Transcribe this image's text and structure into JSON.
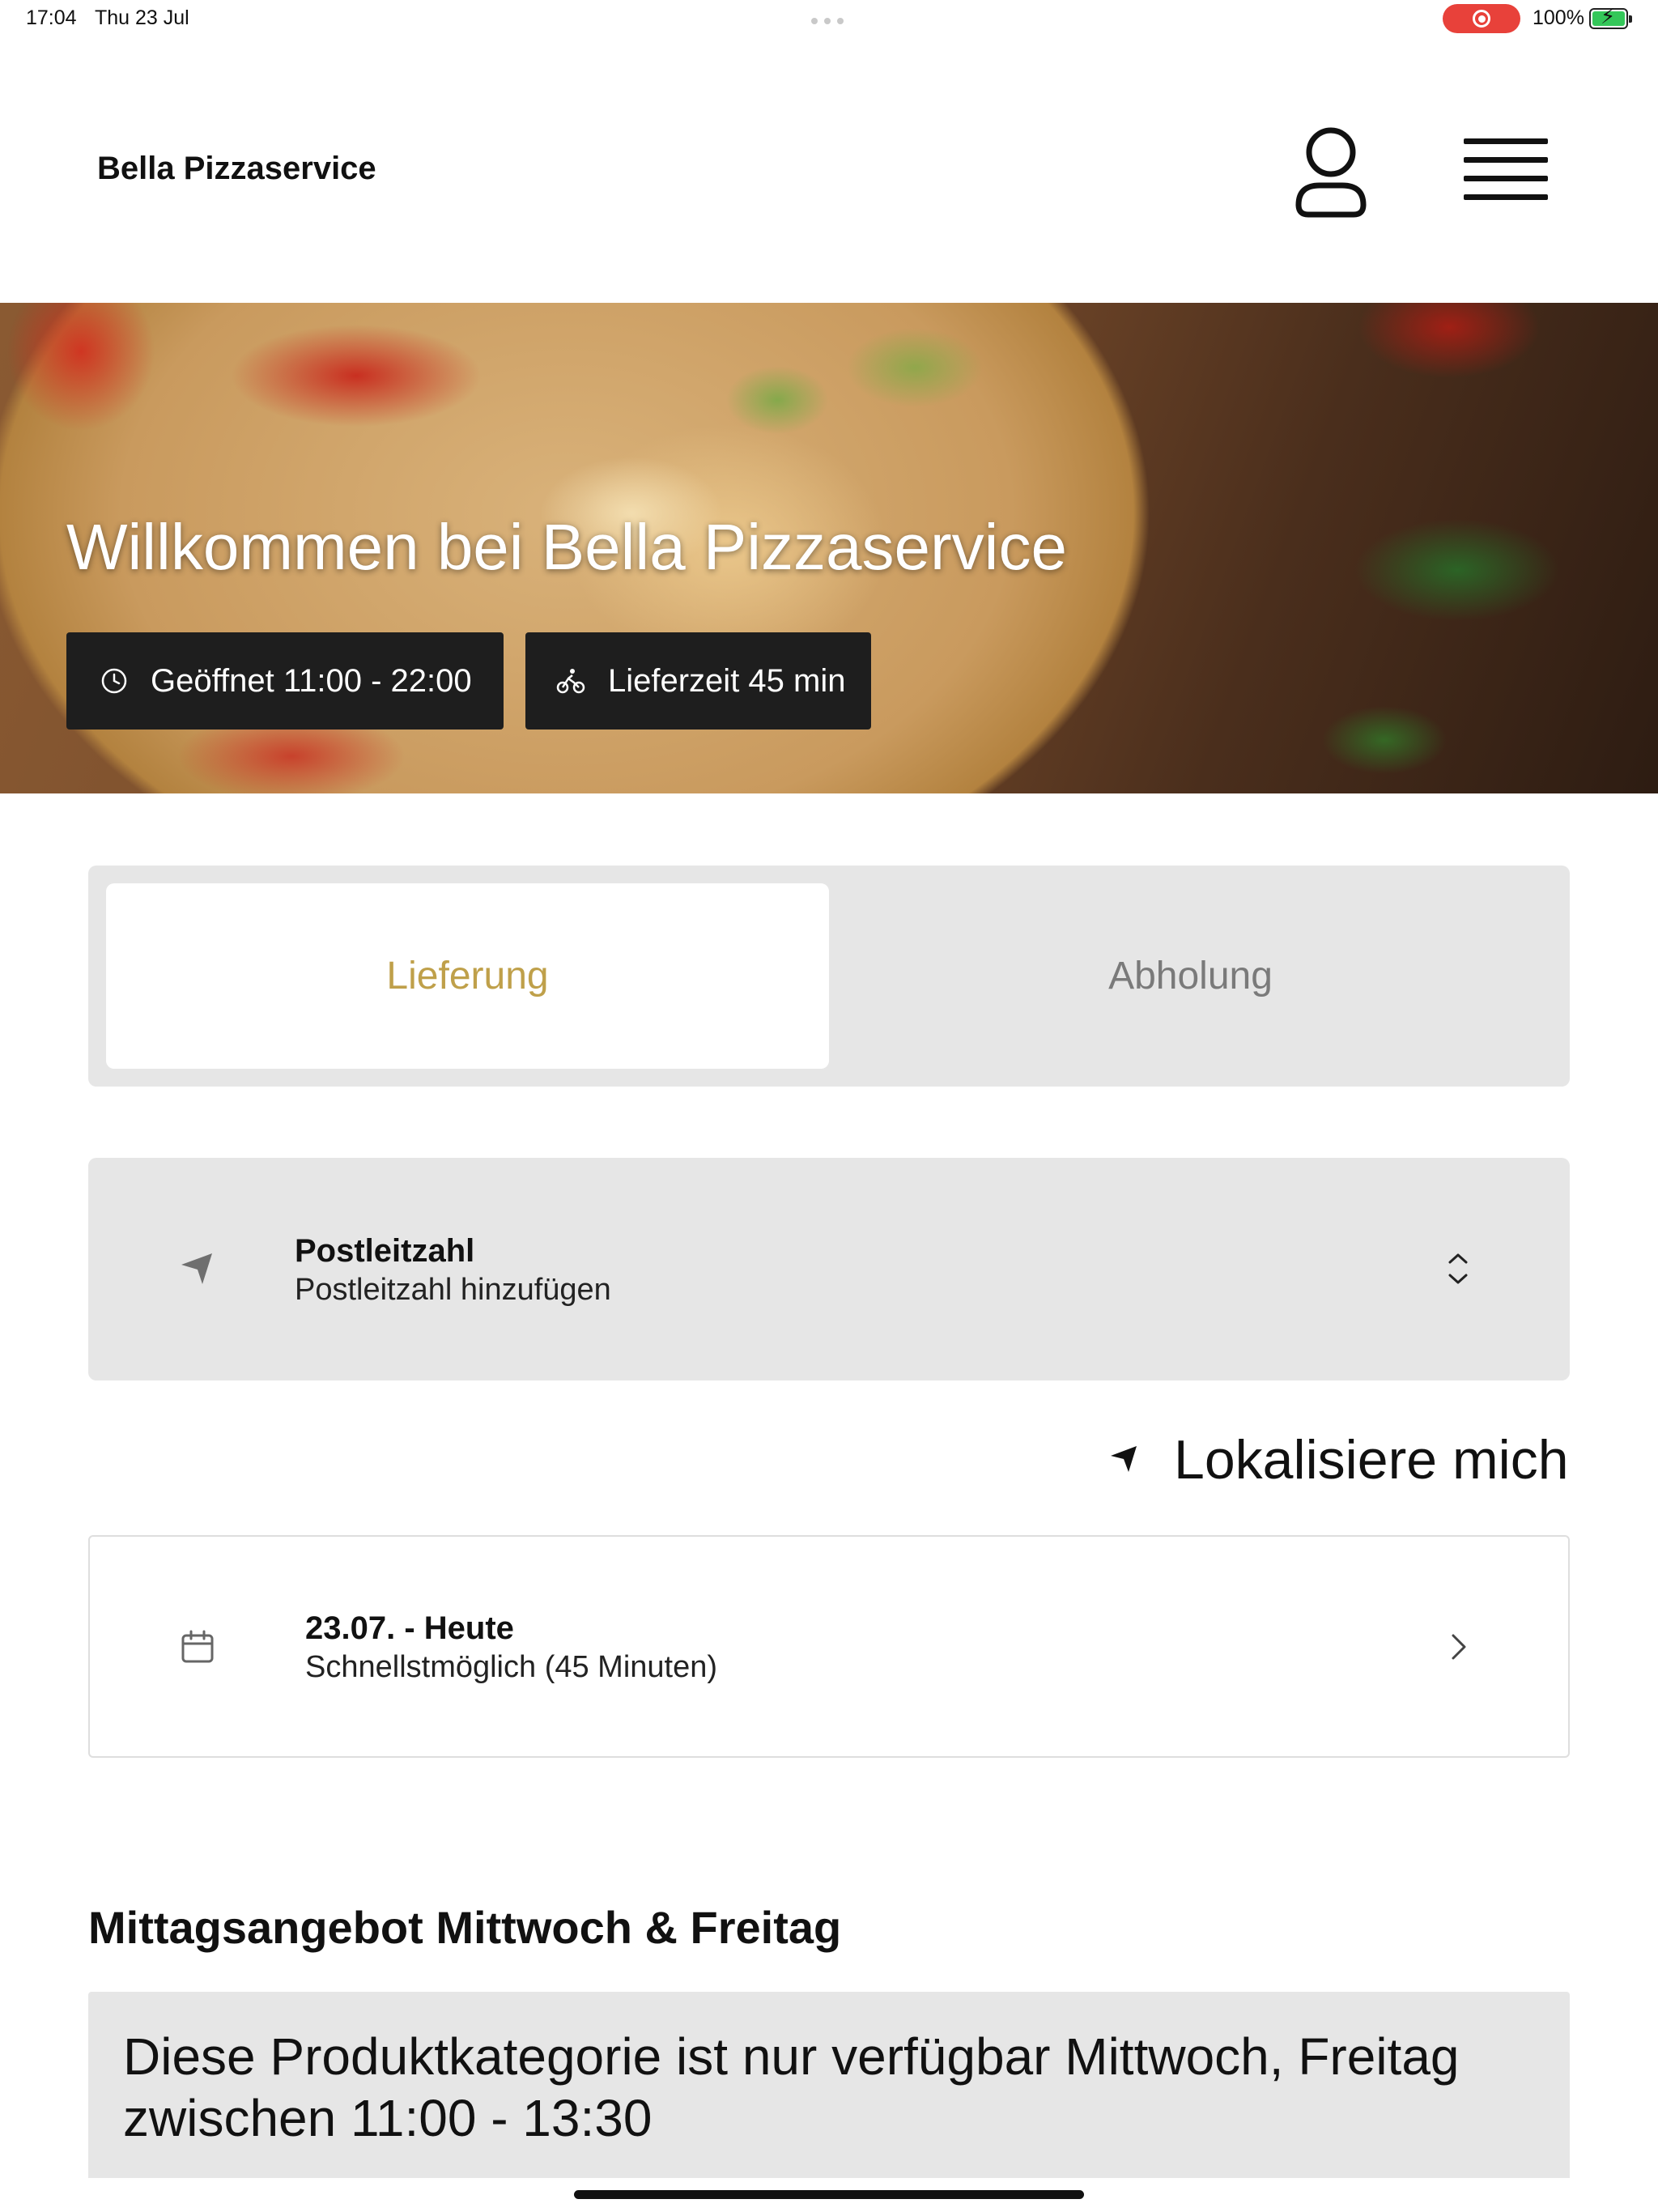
{
  "status_bar": {
    "time": "17:04",
    "date": "Thu 23 Jul",
    "battery_percent": "100%",
    "battery_level": 1.0,
    "recording_color": "#e8413a"
  },
  "header": {
    "brand": "Bella Pizzaservice",
    "account_icon": "user-icon",
    "menu_icon": "hamburger-menu-icon"
  },
  "hero": {
    "title": "Willkommen bei Bella Pizzaservice",
    "opening_hours": "Geöffnet 11:00 - 22:00",
    "opening_icon": "clock-icon",
    "delivery_time": "Lieferzeit 45 min",
    "delivery_icon": "bicycle-icon"
  },
  "order_mode": {
    "options": [
      "Lieferung",
      "Abholung"
    ],
    "selected": "Lieferung",
    "accent_color": "#bfa04a"
  },
  "postcode": {
    "label": "Postleitzahl",
    "placeholder": "Postleitzahl hinzufügen",
    "icon": "navigation-arrow-icon"
  },
  "locate": {
    "label": "Lokalisiere mich",
    "icon": "location-arrow-icon"
  },
  "schedule": {
    "date": "23.07. - Heute",
    "time": "Schnellstmöglich (45 Minuten)",
    "icon": "calendar-icon"
  },
  "lunch_offer": {
    "title": "Mittagsangebot Mittwoch & Freitag",
    "notice": "Diese Produktkategorie ist nur verfügbar Mittwoch, Freitag zwischen 11:00 - 13:30"
  }
}
